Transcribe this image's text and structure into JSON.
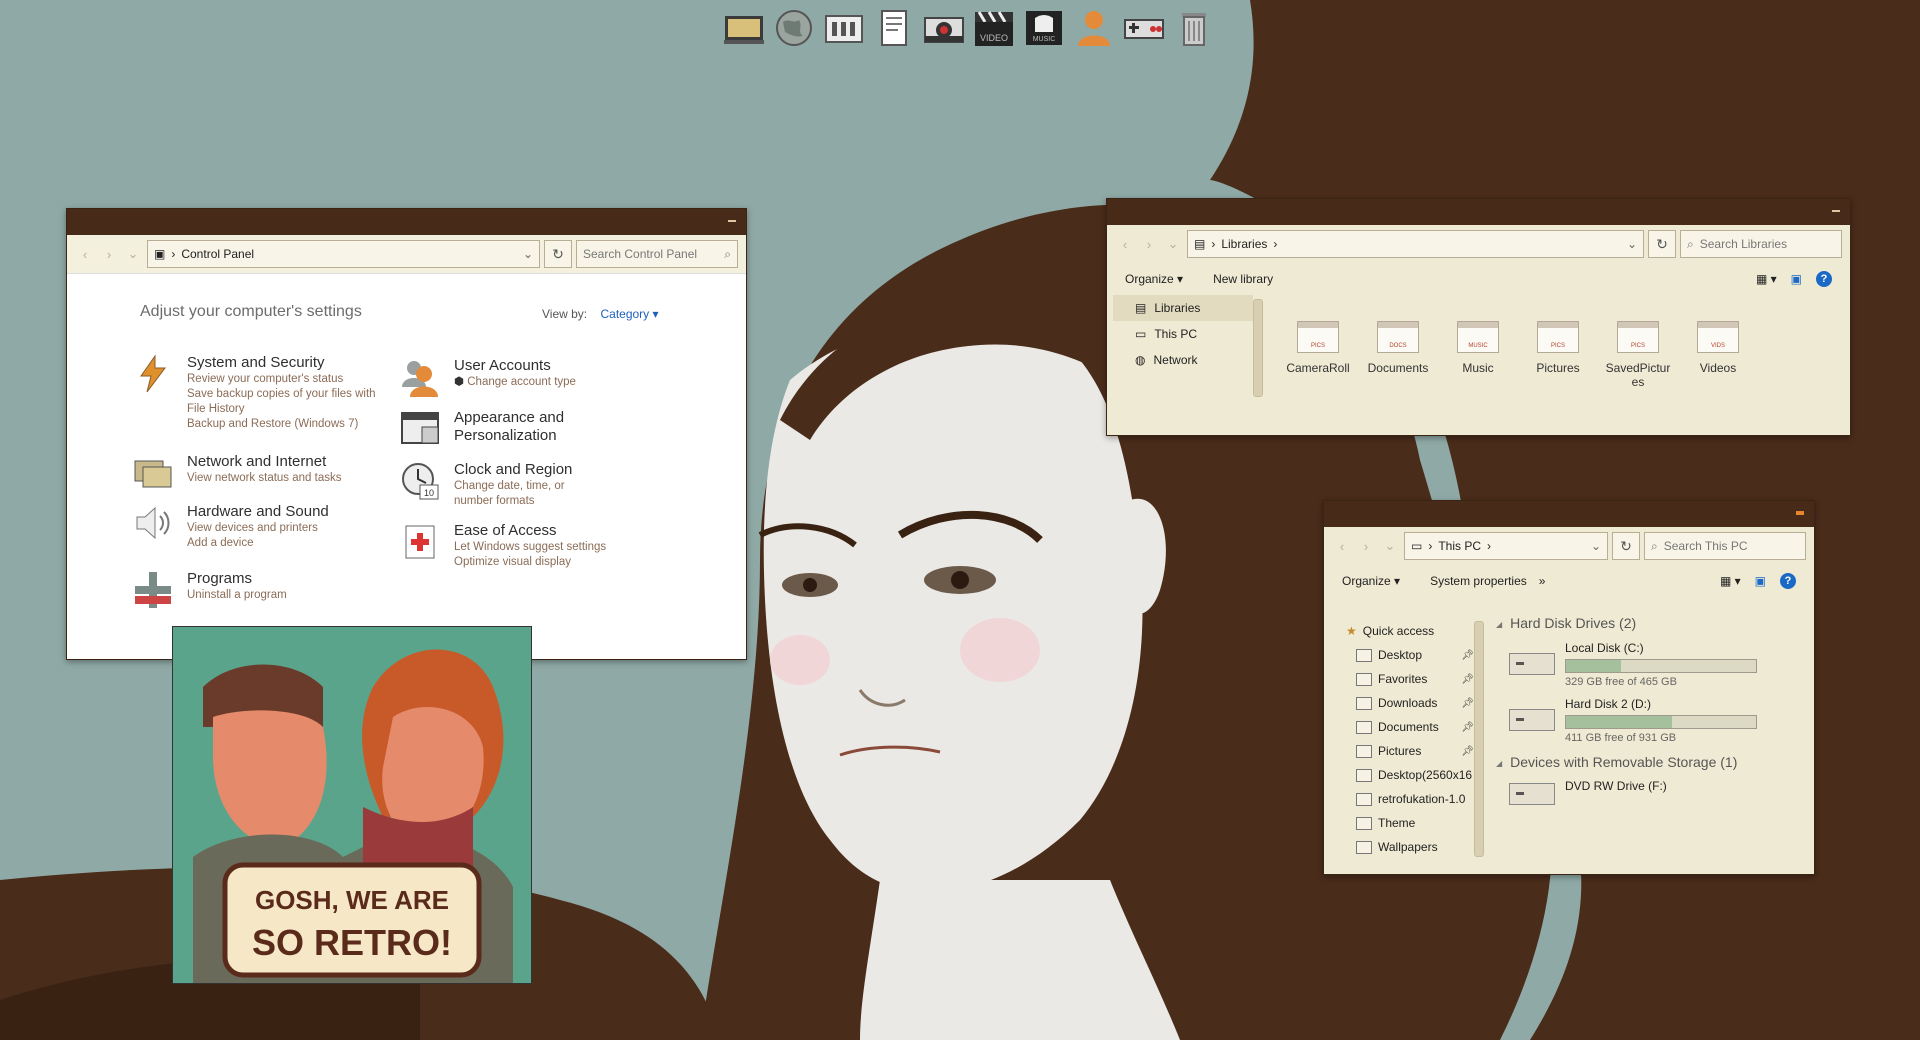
{
  "dock": {
    "items": [
      "computer-icon",
      "globe-icon",
      "mixer-icon",
      "document-icon",
      "camera-icon",
      "video-icon",
      "music-icon",
      "user-icon",
      "nes-controller-icon",
      "trash-icon"
    ],
    "video_label": "VIDEO",
    "music_label": "MUSIC"
  },
  "control_panel": {
    "address": "Control Panel",
    "search_placeholder": "Search Control Panel",
    "heading": "Adjust your computer's settings",
    "view_by_label": "View by:",
    "view_by_value": "Category",
    "categories": [
      {
        "title": "System and Security",
        "links": [
          "Review your computer's status",
          "Save backup copies of your files with File History",
          "Backup and Restore (Windows 7)"
        ]
      },
      {
        "title": "Network and Internet",
        "links": [
          "View network status and tasks"
        ]
      },
      {
        "title": "Hardware and Sound",
        "links": [
          "View devices and printers",
          "Add a device"
        ]
      },
      {
        "title": "Programs",
        "links": [
          "Uninstall a program"
        ]
      },
      {
        "title": "User Accounts",
        "links": [
          "Change account type"
        ]
      },
      {
        "title": "Appearance and Personalization",
        "links": []
      },
      {
        "title": "Clock and Region",
        "links": [
          "Change date, time, or number formats"
        ]
      },
      {
        "title": "Ease of Access",
        "links": [
          "Let Windows suggest settings",
          "Optimize visual display"
        ]
      }
    ]
  },
  "libraries": {
    "address": "Libraries",
    "search_placeholder": "Search Libraries",
    "toolbar": {
      "organize": "Organize",
      "new_library": "New library"
    },
    "sidebar": [
      "Libraries",
      "This PC",
      "Network"
    ],
    "items": [
      {
        "label": "CameraRoll",
        "tag": "PICS"
      },
      {
        "label": "Documents",
        "tag": "DOCS"
      },
      {
        "label": "Music",
        "tag": "MUSIC"
      },
      {
        "label": "Pictures",
        "tag": "PICS"
      },
      {
        "label": "SavedPictures",
        "tag": "PICS"
      },
      {
        "label": "Videos",
        "tag": "VIDS"
      }
    ]
  },
  "this_pc": {
    "address": "This PC",
    "search_placeholder": "Search This PC",
    "toolbar": {
      "organize": "Organize",
      "system_properties": "System properties",
      "more": "»"
    },
    "quick_access_label": "Quick access",
    "sidebar": [
      {
        "label": "Desktop",
        "pinned": true
      },
      {
        "label": "Favorites",
        "pinned": true
      },
      {
        "label": "Downloads",
        "pinned": true
      },
      {
        "label": "Documents",
        "pinned": true
      },
      {
        "label": "Pictures",
        "pinned": true
      },
      {
        "label": "Desktop(2560x16",
        "pinned": false
      },
      {
        "label": "retrofukation-1.0",
        "pinned": false
      },
      {
        "label": "Theme",
        "pinned": false
      },
      {
        "label": "Wallpapers",
        "pinned": false
      }
    ],
    "group_hdd": "Hard Disk Drives (2)",
    "group_removable": "Devices with Removable Storage (1)",
    "drives": [
      {
        "name": "Local Disk (C:)",
        "free": "329 GB free of 465 GB",
        "used_fraction": 0.29
      },
      {
        "name": "Hard Disk 2 (D:)",
        "free": "411 GB free of 931 GB",
        "used_fraction": 0.56
      }
    ],
    "dvd": "DVD RW Drive (F:)"
  },
  "poster": {
    "line1": "GOSH, WE ARE",
    "line2": "SO RETRO!"
  },
  "colors": {
    "titlebar": "#472a17",
    "hair": "#4a2c1a",
    "background": "#8fa9a6",
    "panel": "#efead3",
    "accent_orange": "#e7862e"
  }
}
